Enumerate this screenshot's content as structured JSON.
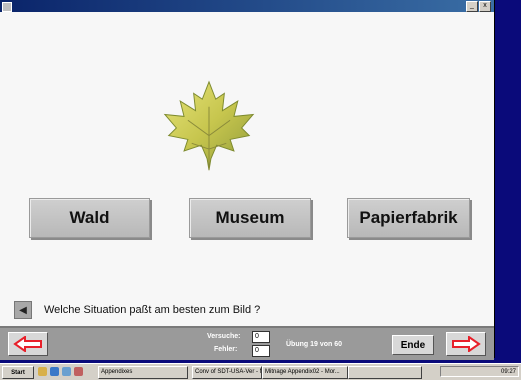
{
  "window": {
    "minimize_label": "_",
    "close_label": "x"
  },
  "choices": [
    {
      "label": "Wald"
    },
    {
      "label": "Museum"
    },
    {
      "label": "Papierfabrik"
    }
  ],
  "question": "Welche Situation paßt am besten zum Bild ?",
  "status": {
    "versuche_label": "Versuche:",
    "versuche_value": "0",
    "fehler_label": "Fehler:",
    "fehler_value": "0",
    "exercise": "Übung 19 von 60",
    "end_label": "Ende"
  },
  "taskbar": {
    "start_label": "Start",
    "tasks": [
      {
        "label": "Appendixes"
      },
      {
        "label": "Conv of SDT-USA-Ver - Mi..."
      },
      {
        "label": "Mitnage Appendix02 - Mor..."
      },
      {
        "label": ""
      }
    ],
    "clock": "09:27"
  },
  "colors": {
    "accent_arrow": "#e8202a",
    "desktop": "#0a0a7a"
  },
  "icons": {
    "leaf": "maple-leaf-icon",
    "speaker": "speaker-icon",
    "prev": "arrow-left-icon",
    "next": "arrow-right-icon"
  }
}
